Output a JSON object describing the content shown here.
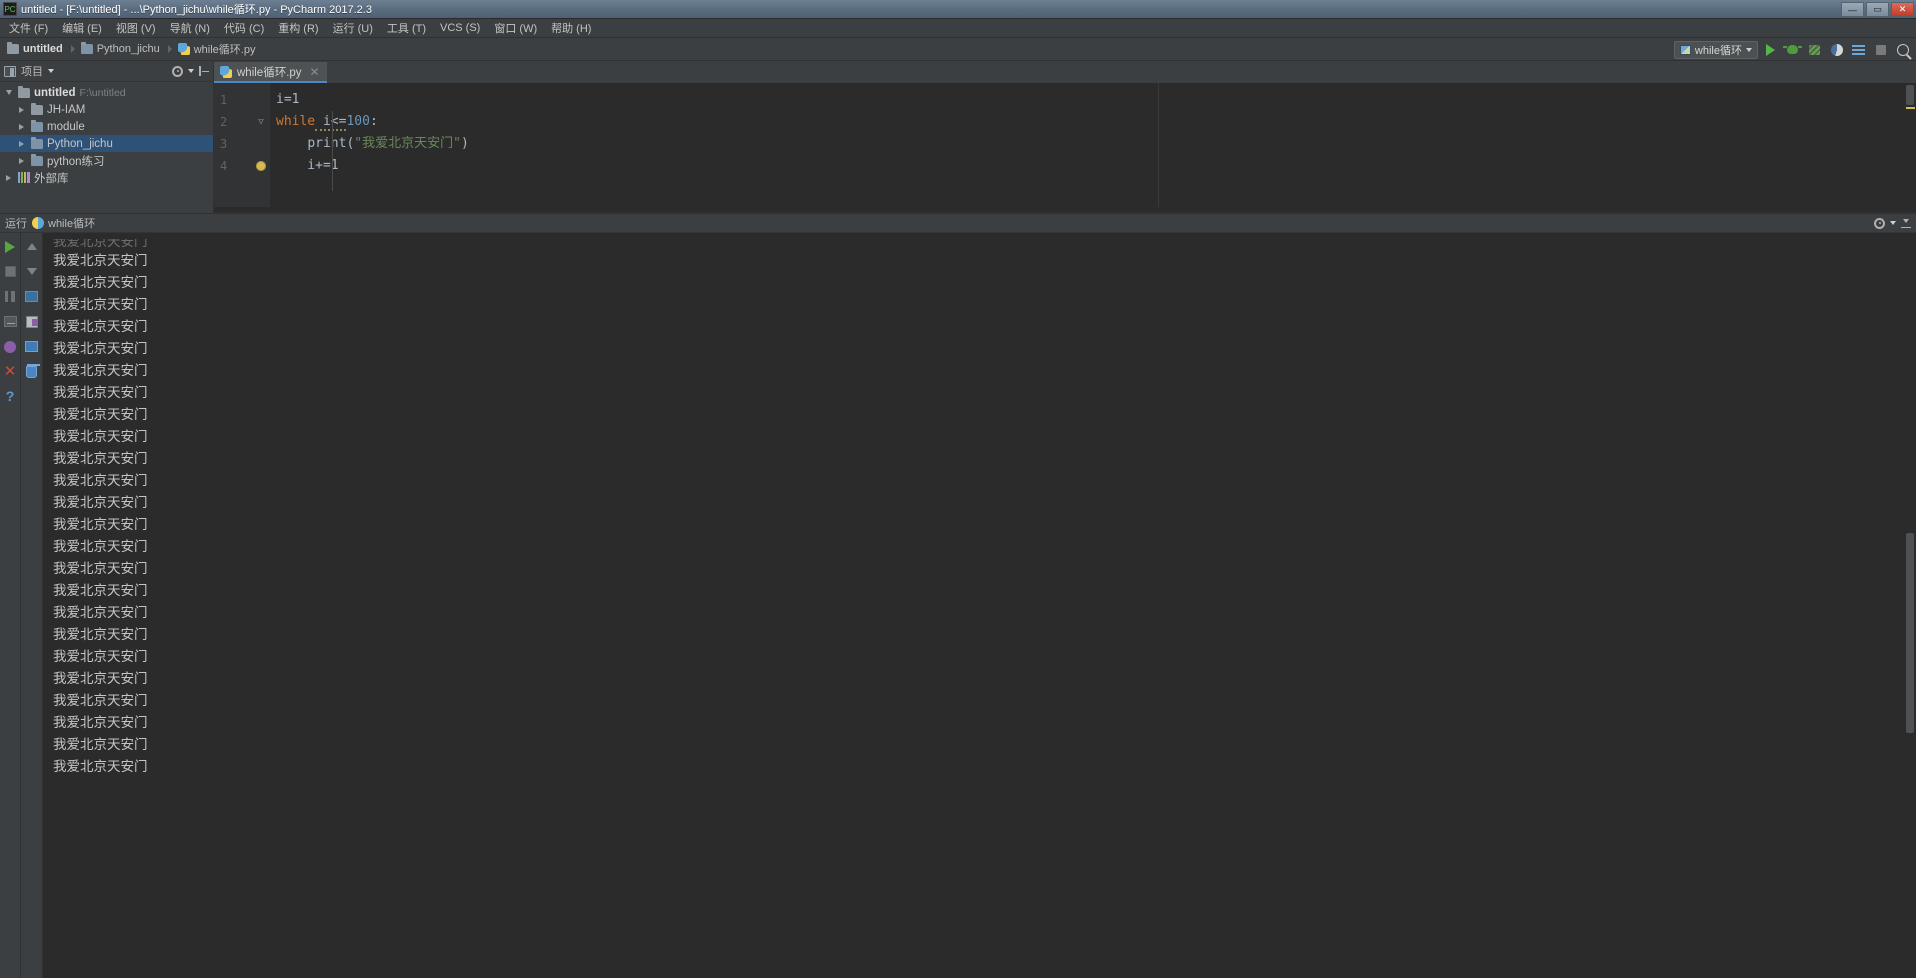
{
  "window": {
    "title": "untitled - [F:\\untitled] - ...\\Python_jichu\\while循环.py - PyCharm 2017.2.3",
    "minimize": "—",
    "maximize": "▭",
    "close": "✕"
  },
  "menubar": {
    "items": [
      {
        "label": "文件 (F)"
      },
      {
        "label": "编辑 (E)"
      },
      {
        "label": "视图 (V)"
      },
      {
        "label": "导航 (N)"
      },
      {
        "label": "代码 (C)"
      },
      {
        "label": "重构 (R)"
      },
      {
        "label": "运行 (U)"
      },
      {
        "label": "工具 (T)"
      },
      {
        "label": "VCS (S)"
      },
      {
        "label": "窗口 (W)"
      },
      {
        "label": "帮助 (H)"
      }
    ]
  },
  "breadcrumb": {
    "items": [
      {
        "label": "untitled",
        "icon": "folder-icon"
      },
      {
        "label": "Python_jichu",
        "icon": "module-folder-icon"
      },
      {
        "label": "while循环.py",
        "icon": "python-file-icon"
      }
    ]
  },
  "toolbar": {
    "run_config": "while循环",
    "buttons": [
      {
        "name": "run-button",
        "icon": "play-icon"
      },
      {
        "name": "debug-button",
        "icon": "bug-icon"
      },
      {
        "name": "coverage-button",
        "icon": "coverage-icon"
      },
      {
        "name": "profile-button",
        "icon": "profiler-icon"
      },
      {
        "name": "concurrency-button",
        "icon": "lines-icon"
      },
      {
        "name": "stop-button",
        "icon": "stop-icon"
      },
      {
        "name": "search-everywhere-button",
        "icon": "search-icon"
      }
    ]
  },
  "project_panel": {
    "title": "项目",
    "tree": [
      {
        "label": "untitled",
        "path": "F:\\untitled",
        "expanded": true,
        "depth": 0,
        "bold": true,
        "icon": "folder-icon",
        "selected": false
      },
      {
        "label": "JH-IAM",
        "path": "",
        "expanded": false,
        "depth": 1,
        "bold": false,
        "icon": "folder-icon",
        "selected": false
      },
      {
        "label": "module",
        "path": "",
        "expanded": false,
        "depth": 1,
        "bold": false,
        "icon": "module-folder-icon",
        "selected": false
      },
      {
        "label": "Python_jichu",
        "path": "",
        "expanded": false,
        "depth": 1,
        "bold": false,
        "icon": "module-folder-icon",
        "selected": true
      },
      {
        "label": "python练习",
        "path": "",
        "expanded": false,
        "depth": 1,
        "bold": false,
        "icon": "module-folder-icon",
        "selected": false
      },
      {
        "label": "外部库",
        "path": "",
        "expanded": false,
        "depth": 0,
        "bold": false,
        "icon": "library-icon",
        "selected": false
      }
    ]
  },
  "editor": {
    "tab": {
      "label": "while循环.py",
      "icon": "python-file-icon",
      "close": "✕"
    },
    "gutter_lines": [
      "1",
      "2",
      "3",
      "4"
    ],
    "code": [
      {
        "n": 1,
        "tokens": [
          {
            "t": "i=1",
            "c": "pl"
          }
        ]
      },
      {
        "n": 2,
        "tokens": [
          {
            "t": "while",
            "c": "kw"
          },
          {
            "t": " i<=",
            "c": "pl"
          },
          {
            "t": "100",
            "c": "num"
          },
          {
            "t": ":",
            "c": "punct"
          }
        ]
      },
      {
        "n": 3,
        "tokens": [
          {
            "t": "    ",
            "c": "pl"
          },
          {
            "t": "print",
            "c": "fn"
          },
          {
            "t": "(",
            "c": "punct"
          },
          {
            "t": "\"我爱北京天安门\"",
            "c": "str"
          },
          {
            "t": ")",
            "c": "punct"
          }
        ]
      },
      {
        "n": 4,
        "tokens": [
          {
            "t": "    i+=1",
            "c": "pl"
          }
        ]
      }
    ]
  },
  "run_window": {
    "title": "运行",
    "tab_label": "while循环",
    "left_tools": [
      {
        "name": "rerun-button",
        "icon": "play-icon"
      },
      {
        "name": "stop-button",
        "icon": "stop-icon"
      },
      {
        "name": "pause-button",
        "icon": "pause-icon"
      },
      {
        "name": "console-button",
        "icon": "console-icon"
      },
      {
        "name": "pin-tab-button",
        "icon": "pin-icon"
      },
      {
        "name": "close-button",
        "icon": "close-icon"
      },
      {
        "name": "help-button",
        "icon": "question-icon"
      }
    ],
    "right_tools": [
      {
        "name": "scroll-up-button",
        "icon": "arrow-up-icon"
      },
      {
        "name": "scroll-down-button",
        "icon": "arrow-down-icon"
      },
      {
        "name": "soft-wrap-button",
        "icon": "wrap-icon"
      },
      {
        "name": "export-button",
        "icon": "export-icon"
      },
      {
        "name": "print-button",
        "icon": "print-icon"
      },
      {
        "name": "clear-all-button",
        "icon": "trash-icon"
      }
    ],
    "output_line": "我爱北京天安门",
    "output_lines": [
      "我爱北京天安门",
      "我爱北京天安门",
      "我爱北京天安门",
      "我爱北京天安门",
      "我爱北京天安门",
      "我爱北京天安门",
      "我爱北京天安门",
      "我爱北京天安门",
      "我爱北京天安门",
      "我爱北京天安门",
      "我爱北京天安门",
      "我爱北京天安门",
      "我爱北京天安门",
      "我爱北京天安门",
      "我爱北京天安门",
      "我爱北京天安门",
      "我爱北京天安门",
      "我爱北京天安门",
      "我爱北京天安门",
      "我爱北京天安门",
      "我爱北京天安门",
      "我爱北京天安门",
      "我爱北京天安门",
      "我爱北京天安门",
      "我爱北京天安门"
    ]
  },
  "colors": {
    "accent": "#4a88c7",
    "selection": "#2d5177",
    "editor_bg": "#2b2b2b",
    "panel_bg": "#3c3f41",
    "keyword": "#cc7832",
    "number": "#6897bb",
    "string": "#6a8759",
    "run_green": "#59a83f"
  }
}
